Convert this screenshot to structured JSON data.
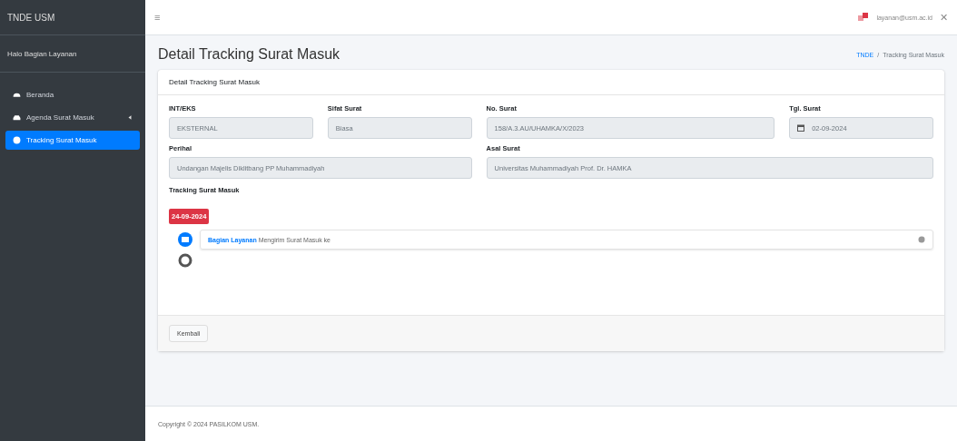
{
  "sidebar": {
    "brand": "TNDE USM",
    "user": "Halo Bagian Layanan",
    "items": [
      {
        "label": "Beranda",
        "expandable": false,
        "selected": false
      },
      {
        "label": "Agenda Surat Masuk",
        "expandable": true,
        "selected": false
      },
      {
        "label": "Tracking Surat Masuk",
        "expandable": false,
        "selected": true
      }
    ]
  },
  "topbar": {
    "menu_icon": "≡",
    "user_email": "layanan@usm.ac.id",
    "close_icon": "✕"
  },
  "page": {
    "title": "Detail Tracking Surat Masuk",
    "breadcrumb": [
      "TNDE",
      "Tracking Surat Masuk"
    ],
    "breadcrumb_separator": "/"
  },
  "card": {
    "header": "Detail Tracking Surat Masuk",
    "fields": [
      {
        "label": "INT/EKS",
        "value": "EKSTERNAL",
        "kind": "text"
      },
      {
        "label": "Sifat Surat",
        "value": "Biasa",
        "kind": "text"
      },
      {
        "label": "No. Surat",
        "value": "158/A.3.AU/UHAMKA/X/2023",
        "kind": "text"
      },
      {
        "label": "Tgl. Surat",
        "value": "02-09-2024",
        "kind": "date"
      },
      {
        "label": "Perihal",
        "value": "Undangan Majelis Diklitbang PP Muhammadiyah",
        "kind": "wide"
      },
      {
        "label": "Asal Surat",
        "value": "Universitas Muhammadiyah Prof. Dr. HAMKA",
        "kind": "wide"
      }
    ],
    "tracking_title": "Tracking Surat Masuk",
    "timeline": {
      "date": "24-09-2024",
      "events": [
        {
          "actor": "Bagian Layanan",
          "text": "Mengirim Surat Masuk ke"
        }
      ]
    },
    "back_button": "Kembali"
  },
  "footer": "Copyright © 2024 PASILKOM USM."
}
